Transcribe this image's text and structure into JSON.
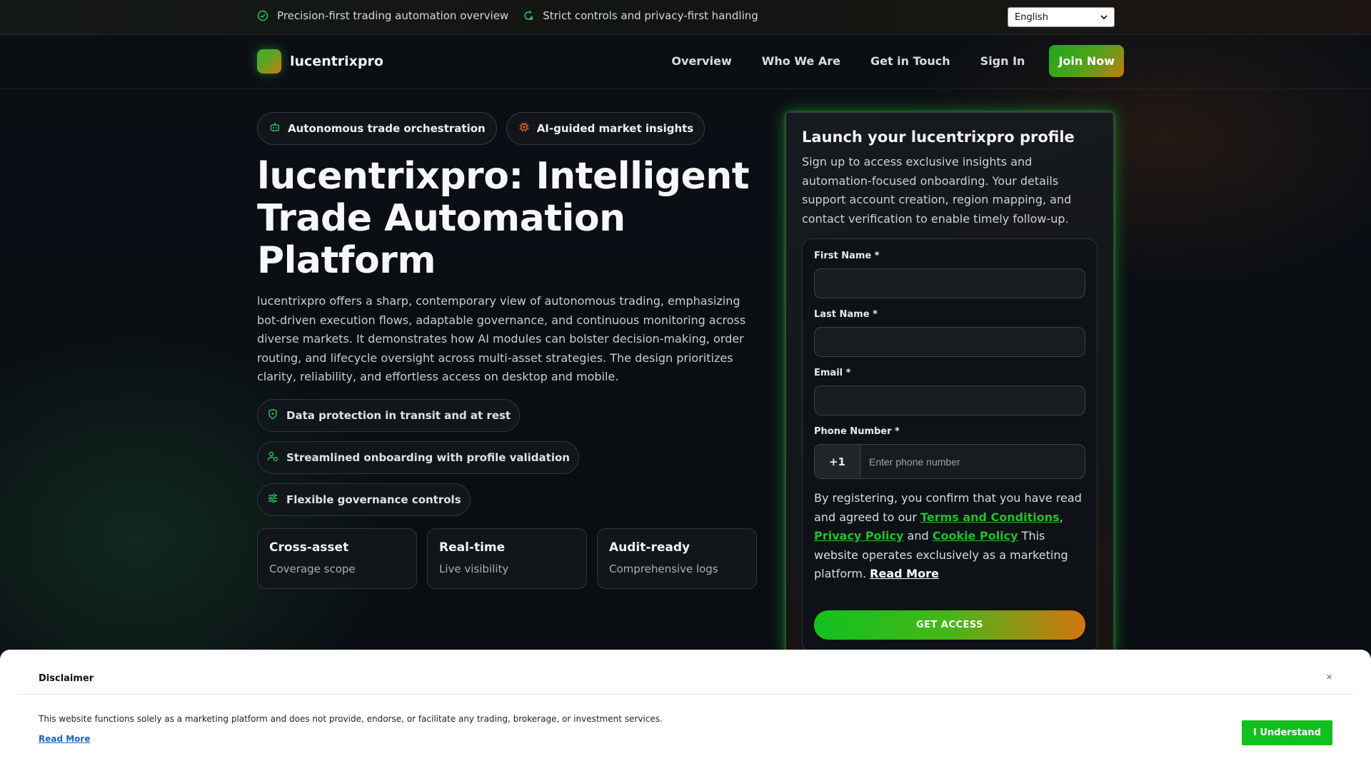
{
  "topbar": {
    "items": [
      {
        "icon": "check-circle-icon",
        "text": "Precision-first trading automation overview"
      },
      {
        "icon": "refresh-lock-icon",
        "text": "Strict controls and privacy-first handling"
      }
    ],
    "language": "English"
  },
  "nav": {
    "brand": "lucentrixpro",
    "links": [
      "Overview",
      "Who We Are",
      "Get in Touch",
      "Sign In"
    ],
    "cta": "Join Now"
  },
  "hero": {
    "chips": [
      {
        "icon": "robot-icon",
        "text": "Autonomous trade orchestration",
        "color": "#22c55e"
      },
      {
        "icon": "chip-icon",
        "text": "AI-guided market insights",
        "color": "#e46a1f"
      }
    ],
    "title": "lucentrixpro: Intelligent Trade Automation Platform",
    "description": "lucentrixpro offers a sharp, contemporary view of autonomous trading, emphasizing bot-driven execution flows, adaptable governance, and continuous monitoring across diverse markets. It demonstrates how AI modules can bolster decision-making, order routing, and lifecycle oversight across multi-asset strategies. The design prioritizes clarity, reliability, and effortless access on desktop and mobile.",
    "features": [
      {
        "icon": "shield-icon",
        "text": "Data protection in transit and at rest"
      },
      {
        "icon": "user-check-icon",
        "text": "Streamlined onboarding with profile validation"
      },
      {
        "icon": "sliders-icon",
        "text": "Flexible governance controls"
      }
    ],
    "stats": [
      {
        "title": "Cross-asset",
        "subtitle": "Coverage scope"
      },
      {
        "title": "Real-time",
        "subtitle": "Live visibility"
      },
      {
        "title": "Audit-ready",
        "subtitle": "Comprehensive logs"
      }
    ]
  },
  "form": {
    "title": "Launch your lucentrixpro profile",
    "description": "Sign up to access exclusive insights and automation-focused onboarding. Your details support account creation, region mapping, and contact verification to enable timely follow-up.",
    "first_name_label": "First Name *",
    "last_name_label": "Last Name *",
    "email_label": "Email *",
    "phone_label": "Phone Number *",
    "phone_code": "+1",
    "phone_placeholder": "Enter phone number",
    "legal_1": "By registering, you confirm that you have read and agreed to our ",
    "terms": "Terms and Conditions",
    "comma": ", ",
    "privacy": "Privacy Policy",
    "and": " and ",
    "cookie": "Cookie Policy",
    "legal_2": " This website operates exclusively as a marketing platform. ",
    "read_more": "Read More",
    "submit": "GET ACCESS"
  },
  "disclaimer": {
    "title": "Disclaimer",
    "close": "×",
    "text": "This website functions solely as a marketing platform and does not provide, endorse, or facilitate any trading, brokerage, or investment services.",
    "read_more": "Read More",
    "button": "I Understand"
  },
  "colors": {
    "accent_green": "#12c11e",
    "accent_orange": "#d4750f",
    "background": "#0a0d12"
  }
}
